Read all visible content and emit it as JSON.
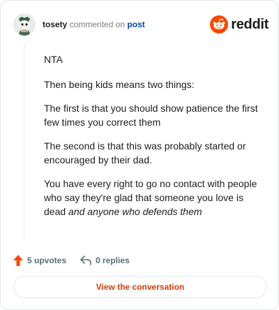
{
  "header": {
    "username": "tosety",
    "commented_text": "commented on",
    "post_link_text": "post",
    "brand": "reddit"
  },
  "comment": {
    "paragraphs": [
      "NTA",
      "Then being kids means two things:",
      "The first is that you should show patience the first few times you correct them",
      "The second is that this was probably started or encouraged by their dad."
    ],
    "last_paragraph_plain": "You have every right to go no contact with people who say they're glad that someone you love is dead ",
    "last_paragraph_italic": "and anyone who defends them"
  },
  "actions": {
    "upvotes": "5 upvotes",
    "replies": "0 replies"
  },
  "cta": {
    "label": "View the conversation"
  },
  "colors": {
    "accent": "#d93a00",
    "link": "#0045ac",
    "upvote": "#ff4500"
  },
  "icons": {
    "avatar": "snoo-avatar",
    "logo": "reddit-snoo-icon",
    "upvote": "upvote-arrow-icon",
    "reply": "reply-arrow-icon"
  }
}
